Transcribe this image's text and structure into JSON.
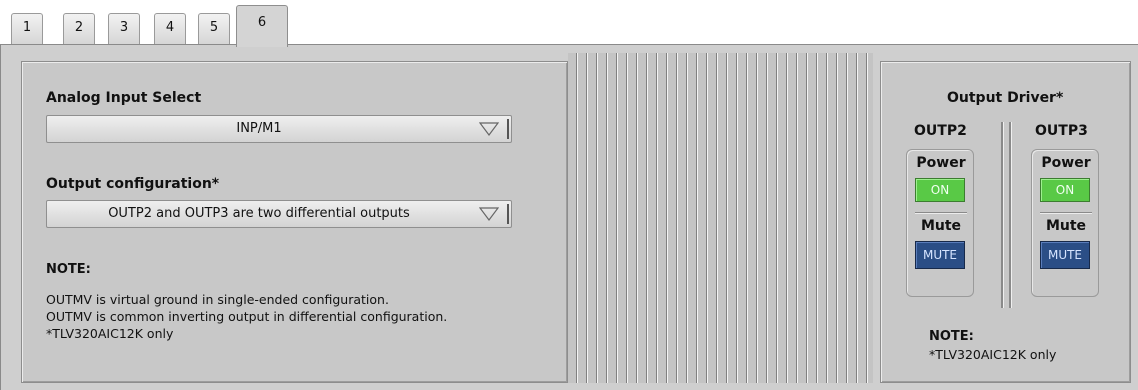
{
  "tabs": [
    {
      "label": "1"
    },
    {
      "label": "2"
    },
    {
      "label": "3"
    },
    {
      "label": "4"
    },
    {
      "label": "5"
    },
    {
      "label": "6"
    }
  ],
  "active_tab": "6",
  "left_panel": {
    "analog_input": {
      "label": "Analog Input Select",
      "value": "INP/M1"
    },
    "output_config": {
      "label": "Output configuration*",
      "value": "OUTP2 and OUTP3 are two differential outputs"
    },
    "note": {
      "heading": "NOTE:",
      "lines": [
        "OUTMV is virtual ground in single-ended configuration.",
        "OUTMV is common inverting output in differential configuration.",
        "*TLV320AIC12K only"
      ]
    }
  },
  "output_driver": {
    "title": "Output Driver*",
    "channels": [
      {
        "name": "OUTP2",
        "power_label": "Power",
        "power_state": "ON",
        "mute_label": "Mute",
        "mute_state": "MUTE"
      },
      {
        "name": "OUTP3",
        "power_label": "Power",
        "power_state": "ON",
        "mute_label": "Mute",
        "mute_state": "MUTE"
      }
    ],
    "note": {
      "heading": "NOTE:",
      "text": "*TLV320AIC12K only"
    }
  },
  "colors": {
    "on_button": "#59c946",
    "mute_button": "#2b4e86",
    "panel": "#c8c8c8"
  }
}
